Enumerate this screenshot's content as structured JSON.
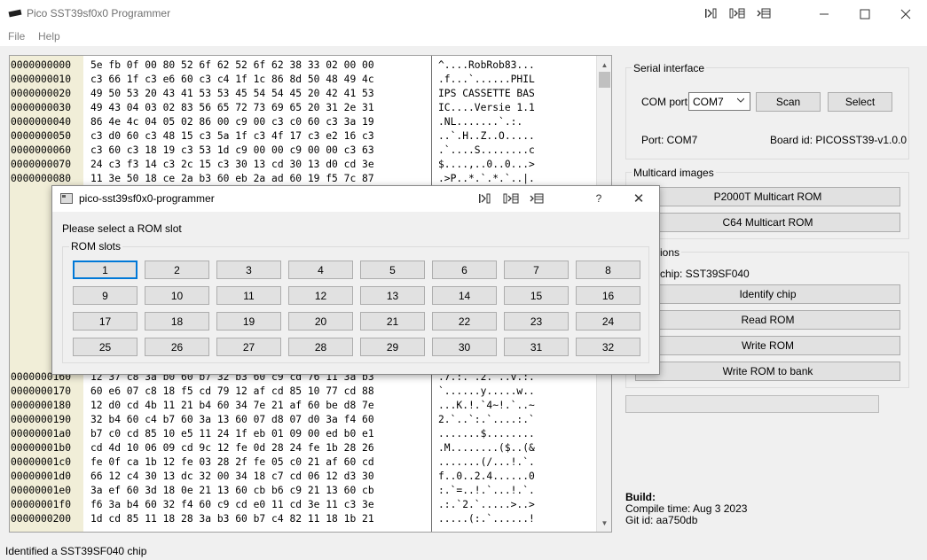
{
  "window": {
    "title": "Pico SST39sf0x0 Programmer"
  },
  "menu": {
    "file": "File",
    "help": "Help"
  },
  "hex": {
    "rows": [
      {
        "addr": "0000000000",
        "hex": "5e fb 0f 00 80 52 6f 62 52 6f 62 38 33 02 00 00",
        "ascii": "^....RobRob83..."
      },
      {
        "addr": "0000000010",
        "hex": "c3 66 1f c3 e6 60 c3 c4 1f 1c 86 8d 50 48 49 4c",
        "ascii": ".f...`......PHIL"
      },
      {
        "addr": "0000000020",
        "hex": "49 50 53 20 43 41 53 53 45 54 54 45 20 42 41 53",
        "ascii": "IPS CASSETTE BAS"
      },
      {
        "addr": "0000000030",
        "hex": "49 43 04 03 02 83 56 65 72 73 69 65 20 31 2e 31",
        "ascii": "IC....Versie 1.1"
      },
      {
        "addr": "0000000040",
        "hex": "86 4e 4c 04 05 02 86 00 c9 00 c3 c0 60 c3 3a 19",
        "ascii": ".NL.......`.:."
      },
      {
        "addr": "0000000050",
        "hex": "c3 d0 60 c3 48 15 c3 5a 1f c3 4f 17 c3 e2 16 c3",
        "ascii": "..`.H..Z..O....."
      },
      {
        "addr": "0000000060",
        "hex": "c3 60 c3 18 19 c3 53 1d c9 00 00 c9 00 00 c3 63",
        "ascii": ".`....S........c"
      },
      {
        "addr": "0000000070",
        "hex": "24 c3 f3 14 c3 2c 15 c3 30 13 cd 30 13 d0 cd 3e",
        "ascii": "$....,..0..0...>"
      },
      {
        "addr": "0000000080",
        "hex": "11 3e 50 18 ce 2a b3 60 eb 2a ad 60 19 f5 7c 87",
        "ascii": ".>P..*.`.*.`..|."
      },
      {
        "addr": "0000000160",
        "hex": "12 37 c8 3a b0 60 b7 32 b3 60 c9 cd 76 11 3a b3",
        "ascii": ".7.:.`.2.`..v.:."
      },
      {
        "addr": "0000000170",
        "hex": "60 e6 07 c8 18 f5 cd 79 12 af cd 85 10 77 cd 88",
        "ascii": "`......y.....w.."
      },
      {
        "addr": "0000000180",
        "hex": "12 d0 cd 4b 11 21 b4 60 34 7e 21 af 60 be d8 7e",
        "ascii": "...K.!.`4~!.`..~"
      },
      {
        "addr": "0000000190",
        "hex": "32 b4 60 c4 b7 60 3a 13 60 07 d8 07 d0 3a f4 60",
        "ascii": "2.`..`:.`....:.`"
      },
      {
        "addr": "00000001a0",
        "hex": "b7 c0 cd 85 10 e5 11 24 1f eb 01 09 00 ed b0 e1",
        "ascii": ".......$........"
      },
      {
        "addr": "00000001b0",
        "hex": "cd 4d 10 06 09 cd 9c 12 fe 0d 28 24 fe 1b 28 26",
        "ascii": ".M........($..(&"
      },
      {
        "addr": "00000001c0",
        "hex": "fe 0f ca 1b 12 fe 03 28 2f fe 05 c0 21 af 60 cd",
        "ascii": ".......(/...!.`."
      },
      {
        "addr": "00000001d0",
        "hex": "66 12 c4 30 13 dc 32 00 34 18 c7 cd 06 12 d3 30",
        "ascii": "f..0..2.4......0"
      },
      {
        "addr": "00000001e0",
        "hex": "3a ef 60 3d 18 0e 21 13 60 cb b6 c9 21 13 60 cb",
        "ascii": ":.`=..!.`...!.`."
      },
      {
        "addr": "00000001f0",
        "hex": "f6 3a b4 60 32 f4 60 c9 cd e0 11 cd 3e 11 c3 3e",
        "ascii": ".:.`2.`.....>..>"
      },
      {
        "addr": "0000000200",
        "hex": "1d cd 85 11 18 28 3a b3 60 b7 c4 82 11 18 1b 21",
        "ascii": ".....(:.`......!"
      }
    ]
  },
  "serial": {
    "title": "Serial interface",
    "com_port_label": "COM port",
    "com_port_value": "COM7",
    "scan": "Scan",
    "select": "Select",
    "port_text": "Port: COM7",
    "board_text": "Board id: PICOSST39-v1.0.0"
  },
  "multicard": {
    "title": "Multicard images",
    "p2000t": "P2000T Multicart ROM",
    "c64": "C64 Multicart ROM"
  },
  "operations": {
    "title_visible": "ions",
    "chip_text": "chip: SST39SF040",
    "identify": "Identify chip",
    "read": "Read ROM",
    "write": "Write ROM",
    "write_bank": "Write ROM to bank"
  },
  "build": {
    "heading": "Build:",
    "compile_time": "Compile time: Aug 3 2023",
    "git_id": "Git id: aa750db"
  },
  "status": {
    "text": "Identified a SST39SF040 chip"
  },
  "dialog": {
    "title": "pico-sst39sf0x0-programmer",
    "help_glyph": "?",
    "close_glyph": "✕",
    "prompt": "Please select a ROM slot",
    "group_title": "ROM slots",
    "slots": [
      "1",
      "2",
      "3",
      "4",
      "5",
      "6",
      "7",
      "8",
      "9",
      "10",
      "11",
      "12",
      "13",
      "14",
      "15",
      "16",
      "17",
      "18",
      "19",
      "20",
      "21",
      "22",
      "23",
      "24",
      "25",
      "26",
      "27",
      "28",
      "29",
      "30",
      "31",
      "32"
    ]
  },
  "icons": {
    "app": "chip-icon",
    "dialog": "window-icon"
  }
}
